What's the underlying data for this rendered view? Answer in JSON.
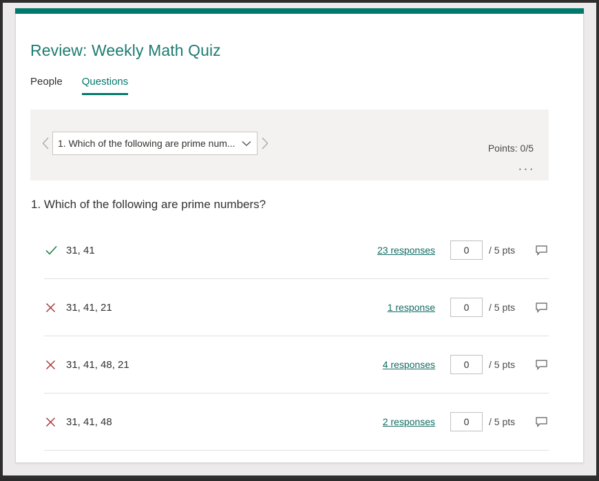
{
  "colors": {
    "accent_teal": "#00786b",
    "title_teal": "#1d7b72",
    "link_teal": "#0f6b61",
    "correct_green": "#107c41",
    "incorrect_red": "#a4373a",
    "panel_gray": "#f3f2f1"
  },
  "header": {
    "title": "Review: Weekly Math Quiz"
  },
  "tabs": [
    {
      "label": "People",
      "active": false
    },
    {
      "label": "Questions",
      "active": true
    }
  ],
  "selector": {
    "prev_icon": "chevron-left-icon",
    "next_icon": "chevron-right-icon",
    "dropdown_icon": "chevron-down-icon",
    "selected_question": "1. Which of the following are prime num...",
    "points_label": "Points: 0/5",
    "more_options_label": "···"
  },
  "question": {
    "text": "1. Which of the following are prime numbers?",
    "answers": [
      {
        "mark": "check-icon",
        "correct": true,
        "label": "31, 41",
        "responses_label": "23 responses",
        "score_value": "0",
        "points_label": "/ 5 pts",
        "comment_icon": "comment-icon"
      },
      {
        "mark": "x-icon",
        "correct": false,
        "label": "31, 41, 21",
        "responses_label": "1 response",
        "score_value": "0",
        "points_label": "/ 5 pts",
        "comment_icon": "comment-icon"
      },
      {
        "mark": "x-icon",
        "correct": false,
        "label": "31, 41, 48, 21",
        "responses_label": "4 responses",
        "score_value": "0",
        "points_label": "/ 5 pts",
        "comment_icon": "comment-icon"
      },
      {
        "mark": "x-icon",
        "correct": false,
        "label": "31, 41, 48",
        "responses_label": "2 responses",
        "score_value": "0",
        "points_label": "/ 5 pts",
        "comment_icon": "comment-icon"
      }
    ]
  }
}
